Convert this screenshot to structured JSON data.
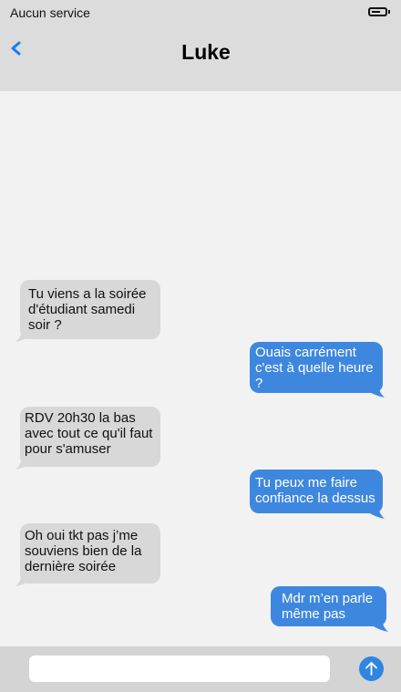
{
  "status_bar": {
    "carrier": "Aucun service",
    "battery_icon": "battery-icon"
  },
  "header": {
    "contact_name": "Luke",
    "back_icon": "chevron-left-icon"
  },
  "colors": {
    "incoming_bubble": "#d8d8d8",
    "outgoing_bubble": "#3e87df",
    "accent": "#2f85e0",
    "header_bg": "#dcdcdc",
    "chat_bg": "#f2f2f2"
  },
  "messages": [
    {
      "direction": "incoming",
      "text": "Tu viens a la soirée d'étudiant samedi soir ?"
    },
    {
      "direction": "outgoing",
      "text": "Ouais carrément c'est à quelle heure ?"
    },
    {
      "direction": "incoming",
      "text": "RDV 20h30 la bas avec tout ce qu'il faut pour s'amuser"
    },
    {
      "direction": "outgoing",
      "text": "Tu peux me faire confiance la dessus"
    },
    {
      "direction": "incoming",
      "text": "Oh oui tkt pas j’me souviens bien de la dernière soirée"
    },
    {
      "direction": "outgoing",
      "text": "Mdr m’en parle même pas"
    }
  ],
  "composer": {
    "input_value": "",
    "input_placeholder": "",
    "send_icon": "arrow-up-icon"
  }
}
